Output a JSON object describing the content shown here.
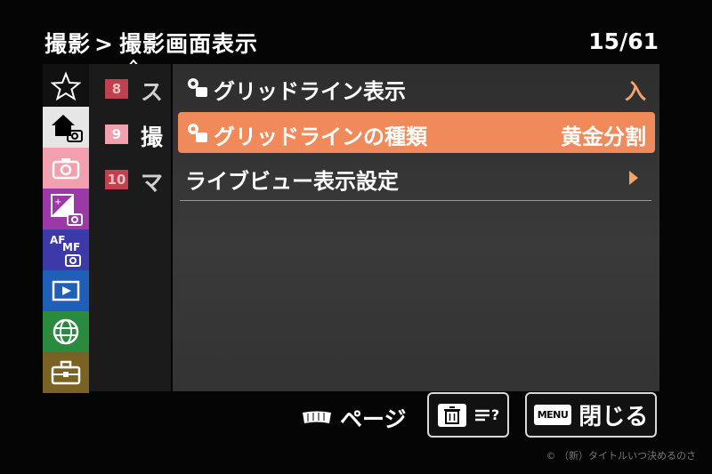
{
  "header": {
    "path_root": "撮影",
    "separator": ">",
    "path_current": "撮影画面表示",
    "page_indicator": "15/61"
  },
  "categories": [
    {
      "icon": "star-icon",
      "color": "#111111"
    },
    {
      "icon": "home-camera-icon",
      "color": "#e6e6e6"
    },
    {
      "icon": "camera-icon",
      "color": "#f2a0ae"
    },
    {
      "icon": "exposure-camera-icon",
      "color": "#9b3aa6"
    },
    {
      "icon": "af-mf-camera-icon",
      "color": "#3b3aa8"
    },
    {
      "icon": "playback-icon",
      "color": "#1f5fb8"
    },
    {
      "icon": "globe-icon",
      "color": "#2a8a3e"
    },
    {
      "icon": "toolbox-icon",
      "color": "#7a6224"
    }
  ],
  "sub_index": [
    {
      "num": "8",
      "text": "ス",
      "num_bg": "#c04050",
      "num_fg": "#e8c0c0"
    },
    {
      "num": "9",
      "text": "撮",
      "num_bg": "#f2a0ae",
      "num_fg": "#ffffff"
    },
    {
      "num": "10",
      "text": "マ",
      "num_bg": "#c04050",
      "num_fg": "#e8c0c0"
    }
  ],
  "menu_items": [
    {
      "label": "グリッドライン表示",
      "value": "入"
    },
    {
      "label": "グリッドラインの種類",
      "value": "黄金分割"
    },
    {
      "label": "ライブビュー表示設定",
      "value": ""
    }
  ],
  "footer": {
    "page_label": "ページ",
    "delete_question": "?",
    "menu_badge": "MENU",
    "close_label": "閉じる",
    "watermark": "© （新）タイトルいつ決めるのさ"
  },
  "colors": {
    "accent": "#f08a5a",
    "value_accent": "#f4a36b"
  }
}
